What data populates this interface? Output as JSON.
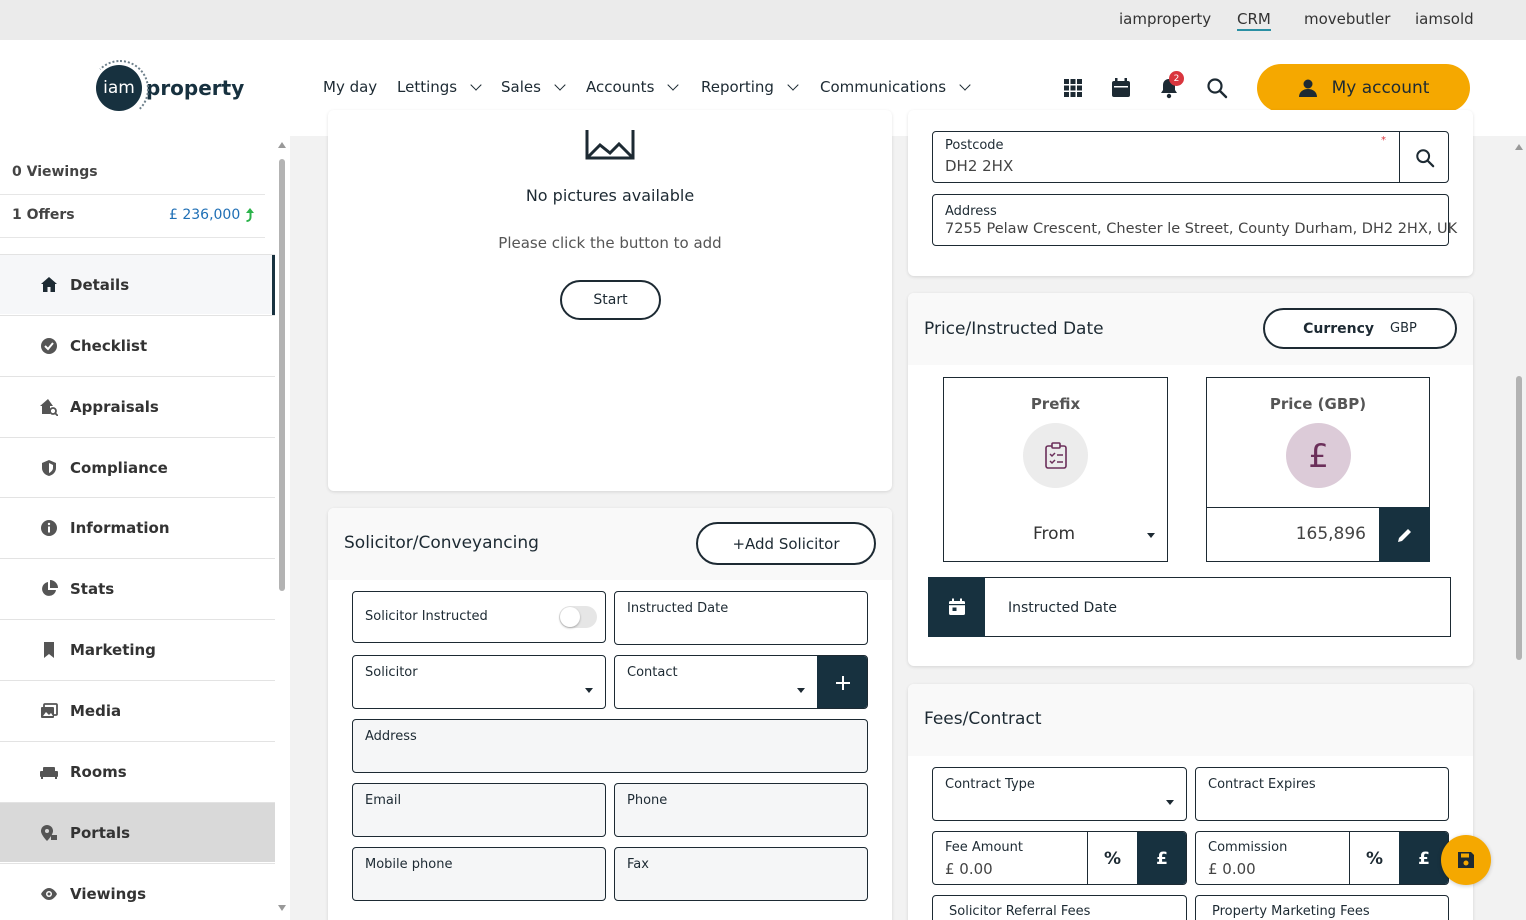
{
  "top_links": [
    "iamproperty",
    "CRM",
    "movebutler",
    "iamsold"
  ],
  "logo": {
    "mark": "iam",
    "word": "property"
  },
  "nav": {
    "myday": "My day",
    "lettings": "Lettings",
    "sales": "Sales",
    "accounts": "Accounts",
    "reporting": "Reporting",
    "communications": "Communications"
  },
  "notifications_count": "2",
  "my_account": "My account",
  "sidebar": {
    "viewings": "0 Viewings",
    "offers": "1 Offers",
    "offer_amount": "£ 236,000",
    "items": [
      "Details",
      "Checklist",
      "Appraisals",
      "Compliance",
      "Information",
      "Stats",
      "Marketing",
      "Media",
      "Rooms",
      "Portals",
      "Viewings"
    ]
  },
  "pictures": {
    "title": "No pictures available",
    "hint": "Please click the button to add",
    "start": "Start"
  },
  "solicitor": {
    "title": "Solicitor/Conveyancing",
    "add": "+Add Solicitor",
    "instructed": "Solicitor Instructed",
    "instructed_date": "Instructed Date",
    "solicitor": "Solicitor",
    "contact": "Contact",
    "address": "Address",
    "email": "Email",
    "phone": "Phone",
    "mobile": "Mobile phone",
    "fax": "Fax"
  },
  "address_card": {
    "postcode_label": "Postcode",
    "postcode": "DH2 2HX",
    "address_label": "Address",
    "address": "7255 Pelaw Crescent, Chester le Street, County Durham, DH2 2HX, UK"
  },
  "price": {
    "title": "Price/Instructed Date",
    "currency_label": "Currency",
    "currency": "GBP",
    "prefix_label": "Prefix",
    "prefix_value": "From",
    "price_label": "Price (GBP)",
    "price_value": "165,896",
    "pound": "£",
    "instructed_date": "Instructed Date"
  },
  "fees": {
    "title": "Fees/Contract",
    "contract_type": "Contract Type",
    "contract_expires": "Contract Expires",
    "fee_amount": "Fee Amount",
    "fee_value": "£ 0.00",
    "commission": "Commission",
    "commission_value": "£ 0.00",
    "percent": "%",
    "pound": "£",
    "solicitor_referral": "Solicitor Referral Fees",
    "property_marketing": "Property Marketing Fees"
  },
  "colors": {
    "accent": "#f5a800",
    "dark": "#17313f",
    "offer": "#1f6fb5",
    "arrow": "#2bb34a"
  }
}
